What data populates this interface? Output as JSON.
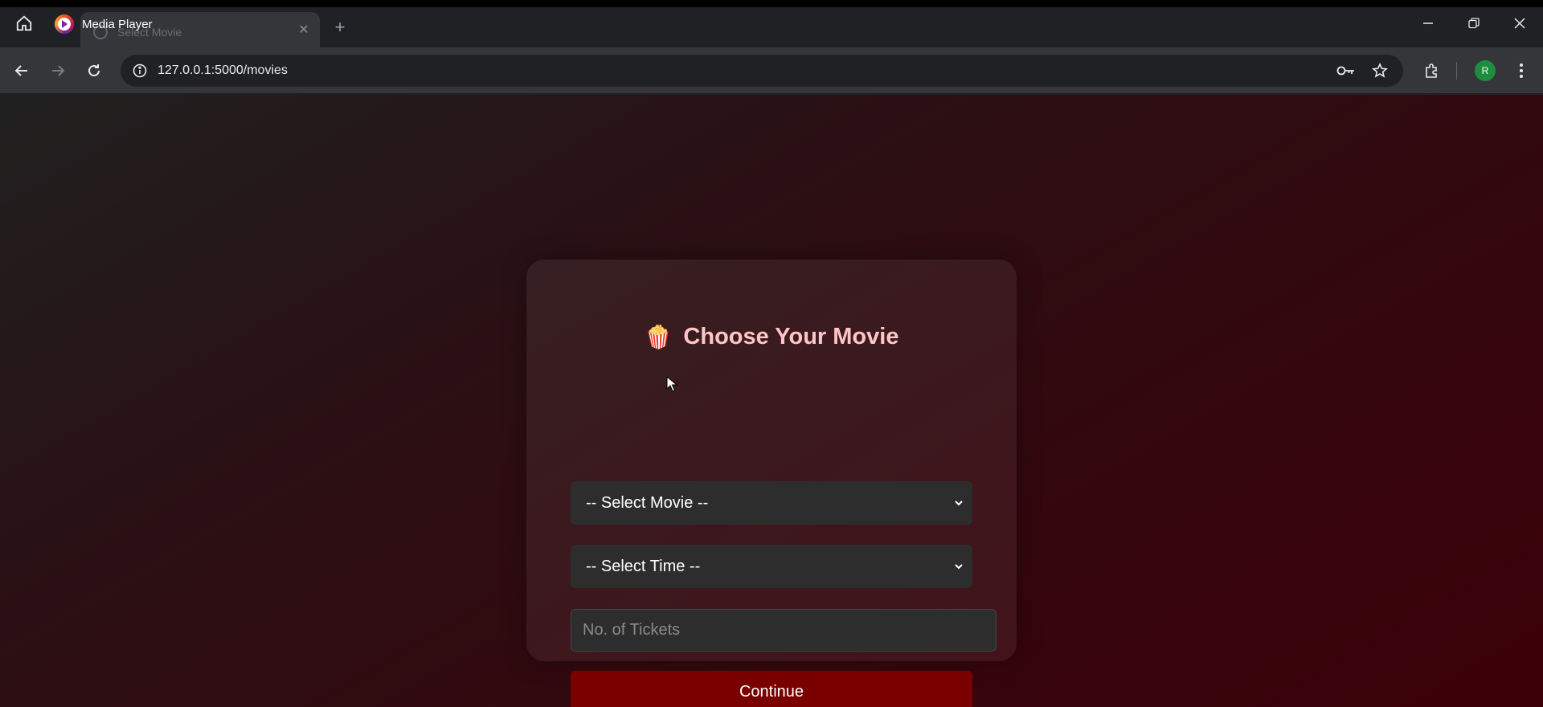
{
  "browser": {
    "tab_label": "Select Movie",
    "media_overlay_title": "Media Player",
    "url": "127.0.0.1:5000/movies",
    "profile_initial": "R",
    "icons": {
      "home": "home-icon",
      "back": "back-arrow-icon",
      "forward": "forward-arrow-icon",
      "reload": "reload-icon",
      "info": "info-icon",
      "password": "key-icon",
      "bookmark": "star-icon",
      "extensions": "puzzle-icon",
      "menu": "kebab-menu-icon",
      "minimize": "minimize-icon",
      "restore": "restore-icon",
      "close": "close-icon",
      "new_tab": "plus-icon"
    }
  },
  "page": {
    "title_emoji": "🍿",
    "title": "Choose Your Movie",
    "movie_select": "-- Select Movie --",
    "time_select": "-- Select Time --",
    "tickets_placeholder": "No. of Tickets",
    "continue_label": "Continue"
  },
  "colors": {
    "accent_button": "#7a0000",
    "title_text": "#ffc6c6",
    "profile_avatar": "#1e8e3e"
  }
}
